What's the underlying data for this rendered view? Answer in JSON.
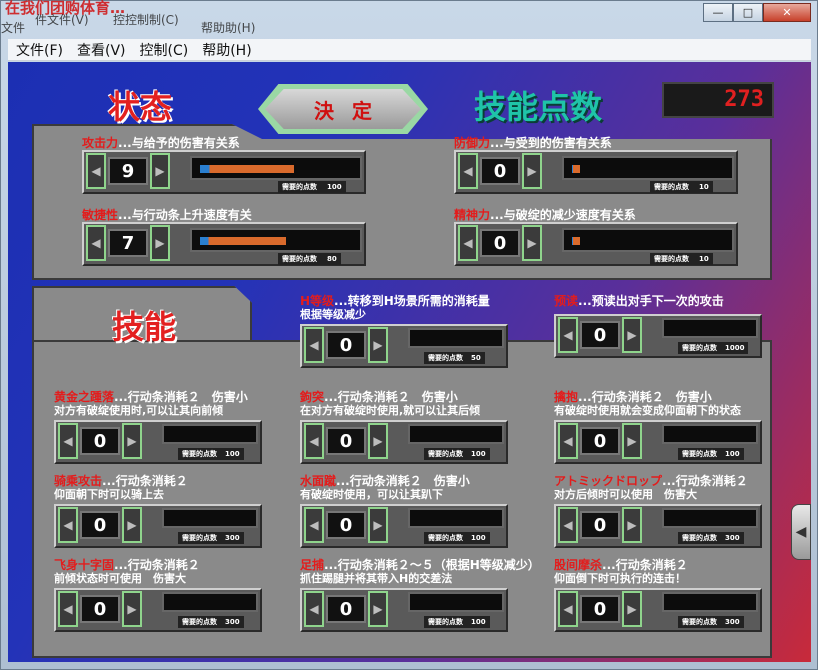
{
  "window": {
    "title": "在我们团购体育…",
    "ghost_menu": [
      "文件",
      "件文件(V)",
      "控控制制(C)",
      "帮助助(H)"
    ],
    "controls": {
      "minimize": "—",
      "maximize": "□",
      "close": "✕"
    }
  },
  "menu": [
    "文件(F)",
    "查看(V)",
    "控制(C)",
    "帮助(H)"
  ],
  "headers": {
    "status": "状态",
    "skill_points": "技能点数",
    "skills": "技能"
  },
  "skill_points_value": "273",
  "confirm_label": "決定",
  "stats": [
    {
      "name": "攻击力",
      "desc": "...与给予的伤害有关系",
      "value": "9",
      "cost": "需要的点数",
      "cost_value": "100",
      "fill": 0.6
    },
    {
      "name": "防御力",
      "desc": "...与受到的伤害有关系",
      "value": "0",
      "cost": "需要的点数",
      "cost_value": "10",
      "fill": 0.05
    },
    {
      "name": "敏捷性",
      "desc": "...与行动条上升速度有关",
      "value": "7",
      "cost": "需要的点数",
      "cost_value": "80",
      "fill": 0.55
    },
    {
      "name": "精神力",
      "desc": "...与破绽的减少速度有关系",
      "value": "0",
      "cost": "需要的点数",
      "cost_value": "10",
      "fill": 0.05
    }
  ],
  "skills": [
    {
      "name": "H等级",
      "desc": "...转移到H场景所需的消耗量",
      "desc2": "根据等级减少",
      "value": "0",
      "cost_value": "50"
    },
    {
      "name": "预读",
      "desc": "...预读出对手下一次的攻击",
      "desc2": "",
      "value": "0",
      "cost_value": "1000"
    },
    {
      "name": "黄金之踵落",
      "desc": "...行动条消耗２　伤害小",
      "desc2": "对方有破绽使用时,可以让其向前倾",
      "value": "0",
      "cost_value": "100"
    },
    {
      "name": "鉤突",
      "desc": "...行动条消耗２　伤害小",
      "desc2": "在对方有破绽时使用,就可以让其后倾",
      "value": "0",
      "cost_value": "100"
    },
    {
      "name": "擒抱",
      "desc": "...行动条消耗２　伤害小",
      "desc2": "有破绽时使用就会变成仰面朝下的状态",
      "value": "0",
      "cost_value": "100"
    },
    {
      "name": "骑乘攻击",
      "desc": "...行动条消耗２",
      "desc2": "仰面朝下时可以骑上去",
      "value": "0",
      "cost_value": "300"
    },
    {
      "name": "水面蹴",
      "desc": "...行动条消耗２　伤害小",
      "desc2": "有破绽时使用，可以让其趴下",
      "value": "0",
      "cost_value": "100"
    },
    {
      "name": "アトミックドロップ",
      "desc": "...行动条消耗２",
      "desc2": "对方后倾时可以使用　伤害大",
      "value": "0",
      "cost_value": "300"
    },
    {
      "name": "飞身十字固",
      "desc": "...行动条消耗２",
      "desc2": "前倾状态时可使用　伤害大",
      "value": "0",
      "cost_value": "300"
    },
    {
      "name": "足捕",
      "desc": "...行动条消耗２～５（根据H等级减少）",
      "desc2": "抓住踢腿并将其带入H的交差法",
      "value": "0",
      "cost_value": "100"
    },
    {
      "name": "股间摩杀",
      "desc": "...行动条消耗２",
      "desc2": "仰面倒下时可执行的连击！",
      "value": "0",
      "cost_value": "300"
    }
  ],
  "cost_label": "需要的点数",
  "icons": {
    "left": "triangle-left-icon",
    "right": "triangle-right-icon",
    "side": "chevron-left-icon"
  }
}
